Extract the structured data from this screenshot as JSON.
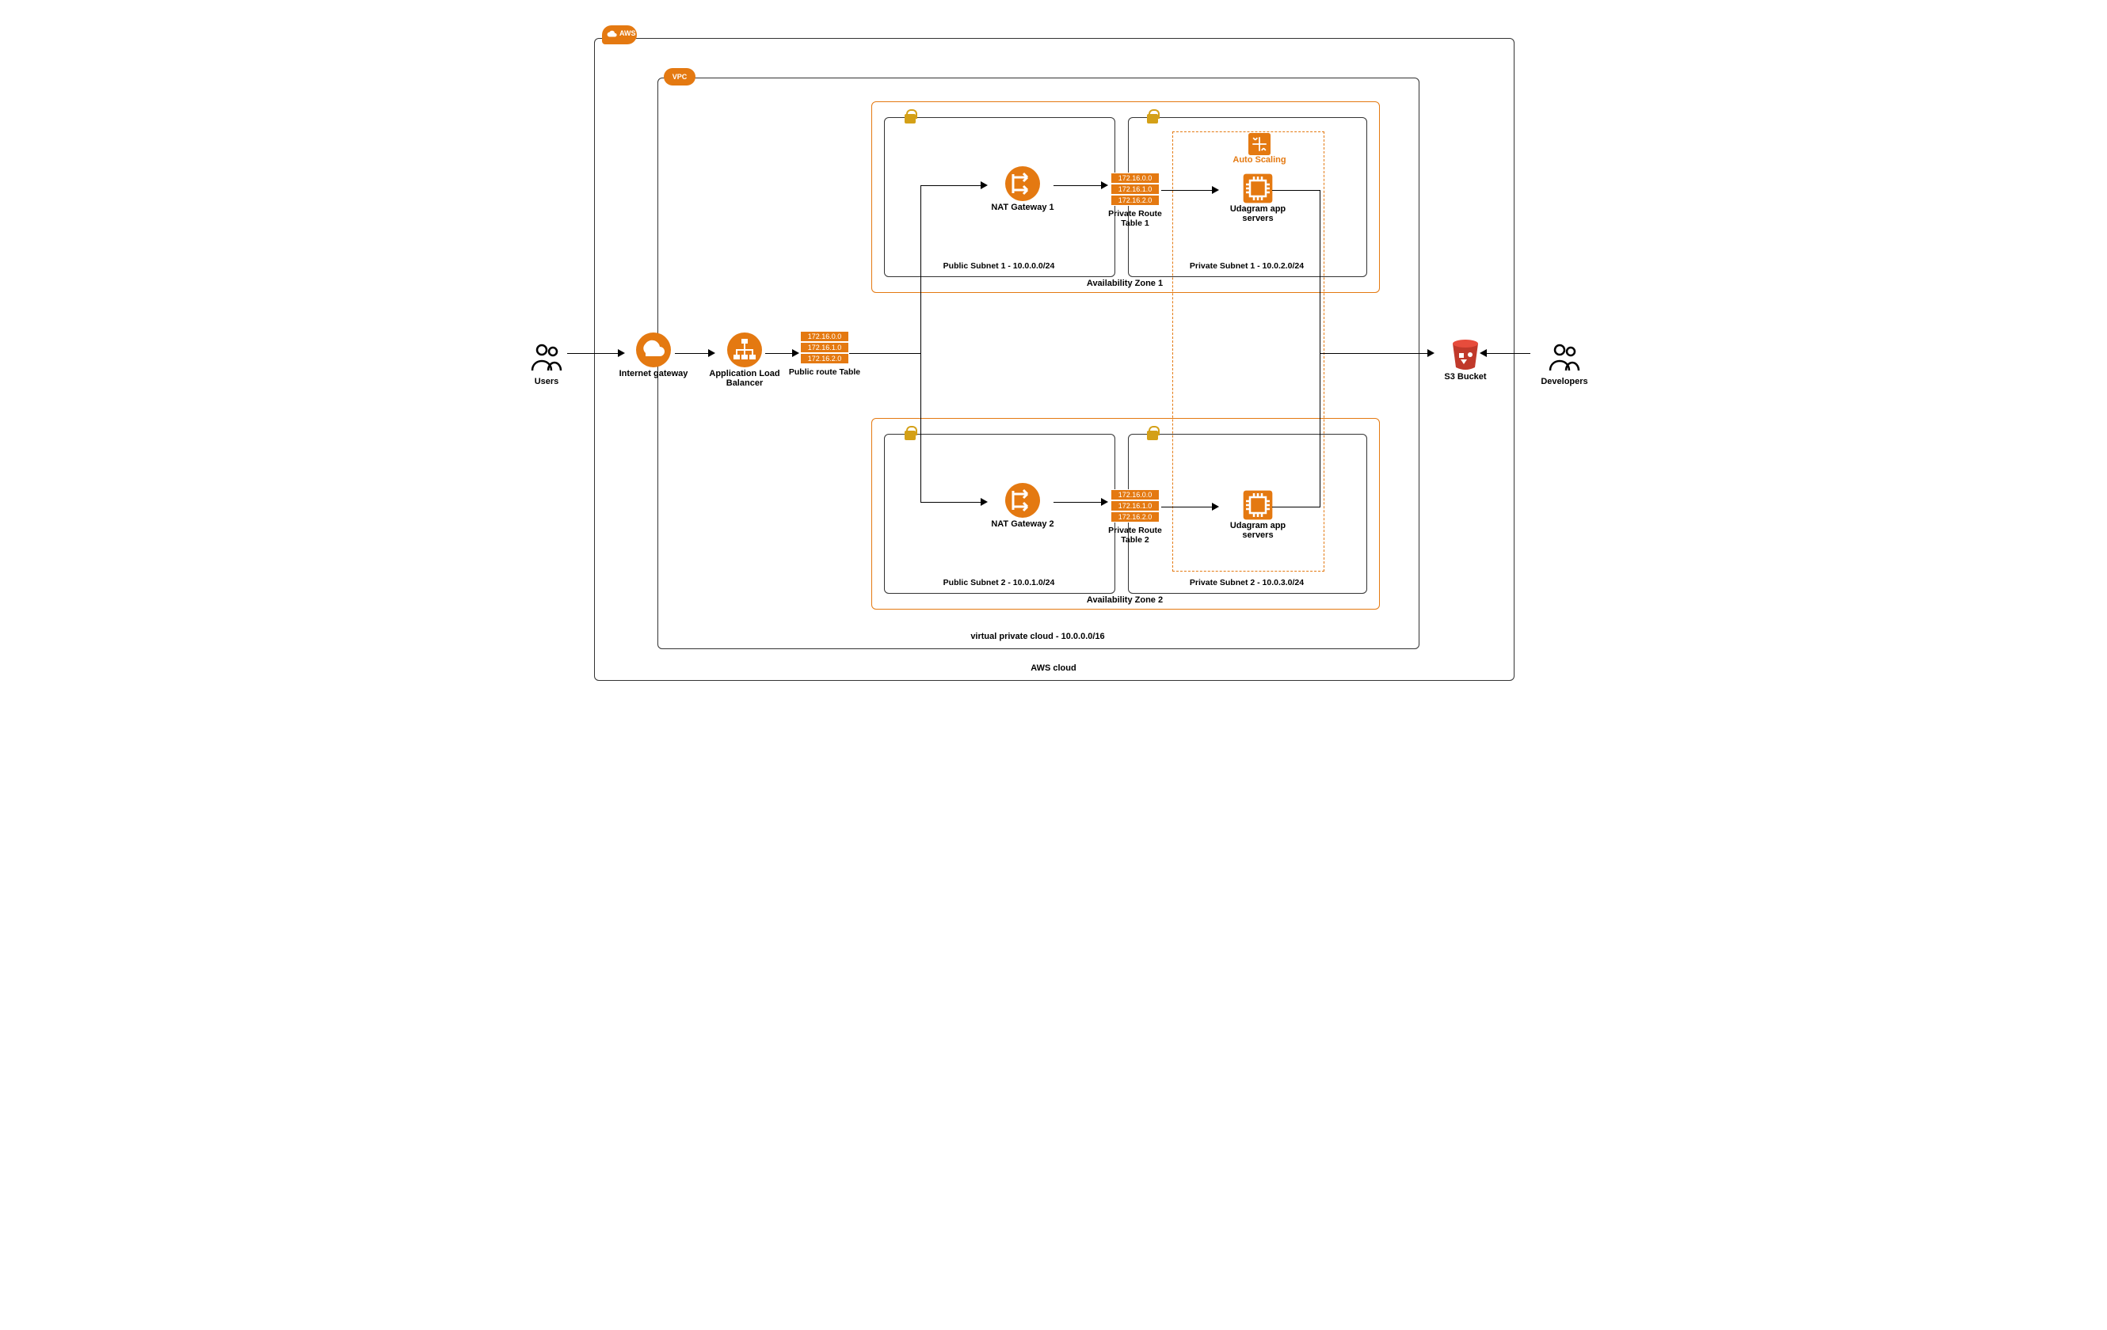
{
  "outside": {
    "users": "Users",
    "developers": "Developers"
  },
  "cloud": {
    "badge": "AWS",
    "label": "AWS cloud",
    "internet_gateway": "Internet gateway",
    "s3": "S3 Bucket"
  },
  "vpc": {
    "badge": "VPC",
    "label": "virtual private cloud - 10.0.0.0/16",
    "alb": "Application Load Balancer",
    "public_rt": {
      "label": "Public route Table",
      "rows": [
        "172.16.0.0",
        "172.16.1.0",
        "172.16.2.0"
      ]
    },
    "autoscaling": "Auto Scaling",
    "az": [
      {
        "label": "Availability Zone 1",
        "public_subnet": "Public Subnet 1 - 10.0.0.0/24",
        "private_subnet": "Private Subnet 1 - 10.0.2.0/24",
        "nat": "NAT Gateway 1",
        "private_rt": {
          "label": "Private Route Table 1",
          "rows": [
            "172.16.0.0",
            "172.16.1.0",
            "172.16.2.0"
          ]
        },
        "servers": "Udagram app servers"
      },
      {
        "label": "Availability Zone 2",
        "public_subnet": "Public Subnet 2 - 10.0.1.0/24",
        "private_subnet": "Private Subnet 2 - 10.0.3.0/24",
        "nat": "NAT Gateway 2",
        "private_rt": {
          "label": "Private Route Table 2",
          "rows": [
            "172.16.0.0",
            "172.16.1.0",
            "172.16.2.0"
          ]
        },
        "servers": "Udagram app servers"
      }
    ]
  }
}
